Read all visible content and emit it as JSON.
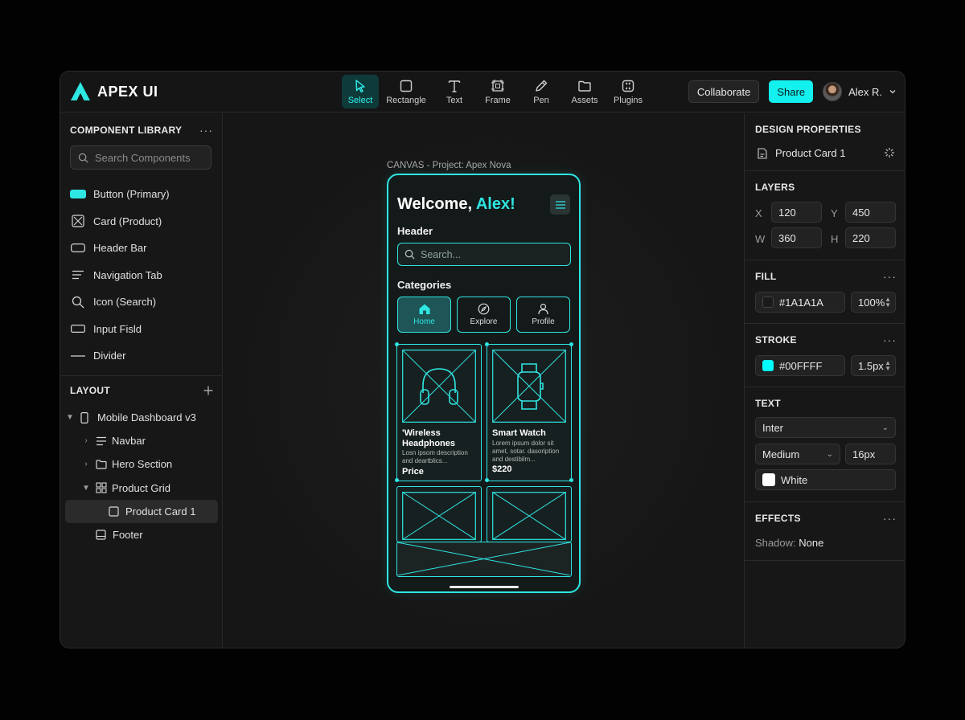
{
  "app": {
    "name": "APEX UI"
  },
  "toolbar": {
    "tools": [
      {
        "label": "Select",
        "icon": "cursor-icon",
        "active": true
      },
      {
        "label": "Rectangle",
        "icon": "rectangle-icon"
      },
      {
        "label": "Text",
        "icon": "text-icon"
      },
      {
        "label": "Frame",
        "icon": "frame-icon"
      },
      {
        "label": "Pen",
        "icon": "pen-icon"
      },
      {
        "label": "Assets",
        "icon": "folder-icon"
      },
      {
        "label": "Plugins",
        "icon": "plugins-icon"
      }
    ],
    "collaborate_label": "Collaborate",
    "share_label": "Share",
    "user_name": "Alex R."
  },
  "library": {
    "title": "COMPONENT LIBRARY",
    "search_placeholder": "Search Components",
    "items": [
      {
        "label": "Button (Primary)",
        "icon": "button-swatch-icon"
      },
      {
        "label": "Card (Product)",
        "icon": "card-image-icon"
      },
      {
        "label": "Header Bar",
        "icon": "header-bar-icon"
      },
      {
        "label": "Navigation Tab",
        "icon": "navigation-lines-icon"
      },
      {
        "label": "Icon (Search)",
        "icon": "search-icon"
      },
      {
        "label": "Input Fisld",
        "icon": "input-field-icon"
      },
      {
        "label": "Divider",
        "icon": "divider-line-icon"
      }
    ]
  },
  "layout": {
    "title": "LAYOUT",
    "tree": [
      {
        "label": "Mobile Dashboard v3",
        "icon": "phone-icon"
      },
      {
        "label": "Navbar",
        "icon": "navbar-icon"
      },
      {
        "label": "Hero Section",
        "icon": "folder-icon"
      },
      {
        "label": "Product Grid",
        "icon": "grid-icon"
      },
      {
        "label": "Product Card 1",
        "icon": "square-icon"
      },
      {
        "label": "Footer",
        "icon": "footer-icon"
      }
    ]
  },
  "canvas": {
    "label": "CANVAS - Project: Apex Nova",
    "phone": {
      "welcome": "Welcome,",
      "welcome_name": "Alex!",
      "header_label": "Header",
      "search_placeholder": "Search...",
      "categories_label": "Categories",
      "categories": [
        "Home",
        "Explore",
        "Profile"
      ],
      "cards": [
        {
          "title_line1": "'Wireless",
          "title_line2": "Headphones",
          "desc_line1": "Losn ipsom description",
          "desc_line2": "and deartblics...",
          "price": "Price"
        },
        {
          "title_line1": "Smart Watch",
          "desc_line1": "Lorem ipsum dolor sit",
          "desc_line2": "amet, sotar. dasoription",
          "desc_line3": "and destibilm...",
          "price": "$220"
        }
      ]
    }
  },
  "properties": {
    "title": "DESIGN PROPERTIES",
    "selected": "Product Card 1",
    "layers": {
      "title": "LAYERS",
      "x_label": "X",
      "x": "120",
      "y_label": "Y",
      "y": "450",
      "w_label": "W",
      "w": "360",
      "h_label": "H",
      "h": "220"
    },
    "fill": {
      "title": "FILL",
      "color": "#1A1A1A",
      "opacity": "100%"
    },
    "stroke": {
      "title": "STROKE",
      "color": "#00FFFF",
      "width": "1.5px"
    },
    "text": {
      "title": "TEXT",
      "font": "Inter",
      "weight": "Medium",
      "size": "16px",
      "color": "White"
    },
    "effects": {
      "title": "EFFECTS",
      "shadow_label": "Shadow:",
      "shadow_value": "None"
    }
  },
  "colors": {
    "accent": "#2ee6e2",
    "share_button": "#13f1ee",
    "fill_swatch": "#1A1A1A",
    "stroke_swatch": "#00FFFF"
  }
}
